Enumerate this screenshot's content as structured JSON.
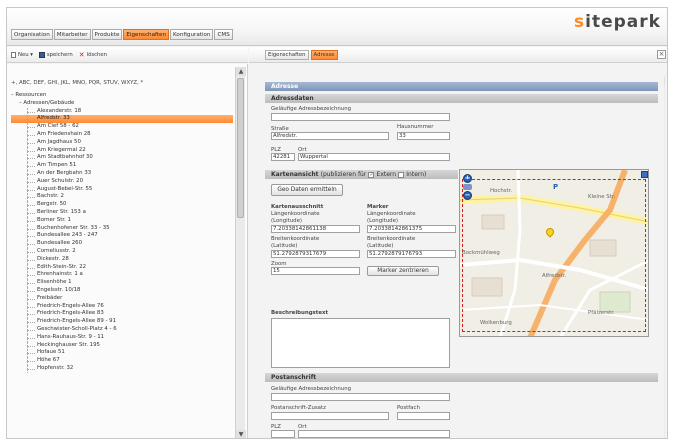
{
  "brand": {
    "logo_s": "s",
    "logo_rest": "itepark",
    "accent_color": "#ff8a30"
  },
  "main_tabs": [
    {
      "label": "Organisation"
    },
    {
      "label": "Mitarbeiter"
    },
    {
      "label": "Produkte"
    },
    {
      "label": "Eigenschaften",
      "active": true
    },
    {
      "label": "Konfiguration"
    },
    {
      "label": "CMS"
    }
  ],
  "left_toolbar": {
    "new_label": "Neu ▾",
    "save_label": "speichern",
    "delete_label": "löschen"
  },
  "right_tabs": [
    {
      "label": "Eigenschaften"
    },
    {
      "label": "Adresse",
      "active": true
    }
  ],
  "close_icon": "×",
  "alpha_filter": "+, ABC, DEF, GHI, JKL, MNO, PQR, STUV, WXYZ, *",
  "tree": {
    "root": "– Ressourcen",
    "group": "– Adressen/Gebäude",
    "items": [
      "Alexanderstr. 18",
      "Alfredstr. 33",
      "Am Clef 58 - 62",
      "Am Friedenshain 28",
      "Am Jagdhaus 50",
      "Am Kriegermal 22",
      "Am Stadtbahnhof 30",
      "Am Timpen 51",
      "An der Bergbahn 33",
      "Auer Schulstr. 20",
      "August-Bebel-Str. 55",
      "Bachstr. 2",
      "Bergstr. 50",
      "Berliner Str. 153 a",
      "Borner Str. 1",
      "Buchenhofener Str. 33 - 35",
      "Bundesallee 243 - 247",
      "Bundesallee 260",
      "Corneliusstr. 2",
      "Dickestr. 28",
      "Edith-Stein-Str. 22",
      "Ehrenhainstr. 1 a",
      "Elisenhöhe 1",
      "Engelsstr. 10/18",
      "Freibäder",
      "Friedrich-Engels-Allee 76",
      "Friedrich-Engels-Allee 83",
      "Friedrich-Engels-Allee 89 - 91",
      "Geschwister-Scholl-Platz 4 - 6",
      "Hans-Rauhaus-Str. 9 - 11",
      "Heckinghauser Str. 195",
      "Hofaue 51",
      "Höhe 67",
      "Hopfenstr. 32"
    ],
    "selected_index": 1
  },
  "form": {
    "section_title": "Adresse",
    "adressdaten_header": "Adressdaten",
    "common_label": "Geläufige Adressbezeichnung",
    "common_value": "",
    "street_label": "Straße",
    "street_value": "Alfredstr.",
    "house_label": "Hausnummer",
    "house_value": "33",
    "plz_label": "PLZ",
    "plz_value": "42281",
    "city_label": "Ort",
    "city_value": "Wuppertal",
    "map_header": "Kartenansicht",
    "map_header_suffix": "(publizieren für",
    "extern_label": "Extern",
    "intern_label": "Intern)",
    "extern_checked": true,
    "intern_checked": false,
    "geo_button": "Geo Daten ermitteln",
    "kartenausschnitt_title": "Kartenausschnitt",
    "marker_title": "Marker",
    "lon_label_1": "Längenkoordinate",
    "lon_label_2": "(Longitude)",
    "lon_map_value": "7.20338142861138",
    "lon_marker_value": "7.20338142861375",
    "lat_label_1": "Breitenkoordinate",
    "lat_label_2": "(Latitude)",
    "lat_map_value": "51.2792879317679",
    "lat_marker_value": "51.2792879176793",
    "zoom_label": "Zoom",
    "zoom_value": "15",
    "center_marker_button": "Marker zentrieren",
    "description_label": "Beschreibungstext",
    "postanschrift_header": "Postanschrift",
    "post_common_label": "Geläufige Adressbezeichnung",
    "post_extra_label": "Postanschrift-Zusatz",
    "postfach_label": "Postfach",
    "post_plz_label": "PLZ",
    "post_city_label": "Ort"
  },
  "map": {
    "labels": [
      "Hochstr.",
      "P",
      "Kleine Str.",
      "Bockmühlweg",
      "Alfredstr.",
      "Wolkenburg",
      "Pfälzerstr."
    ]
  }
}
